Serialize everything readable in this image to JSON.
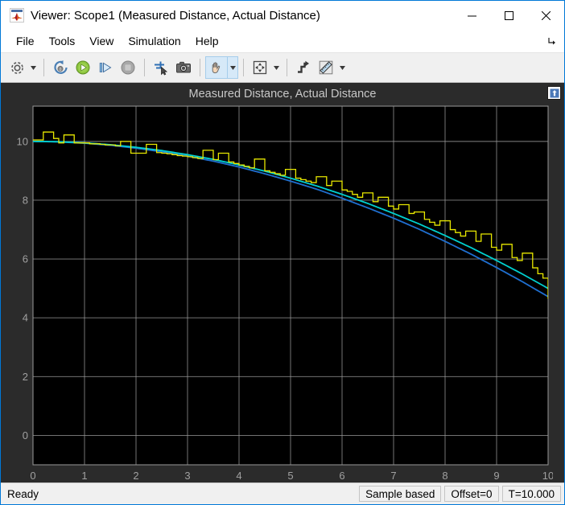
{
  "window": {
    "title": "Viewer: Scope1 (Measured Distance, Actual Distance)",
    "icon": "matlab-logo-icon",
    "minimize_label": "—",
    "maximize_label": "☐",
    "close_label": "✕"
  },
  "menubar": {
    "items": [
      {
        "label": "File"
      },
      {
        "label": "Tools"
      },
      {
        "label": "View"
      },
      {
        "label": "Simulation"
      },
      {
        "label": "Help"
      }
    ],
    "expand_icon": "expand-arrow-icon"
  },
  "toolbar": {
    "buttons": [
      {
        "name": "configuration-properties-button",
        "icon": "gear-icon",
        "tooltip": "Configuration Properties",
        "caret": true,
        "active": false
      },
      {
        "name": "run-back-to-start-button",
        "icon": "rewind-icon",
        "tooltip": "Run back to start",
        "caret": false,
        "active": false
      },
      {
        "name": "run-button",
        "icon": "play-icon",
        "tooltip": "Run",
        "caret": false,
        "active": false
      },
      {
        "name": "step-forward-button",
        "icon": "step-forward-icon",
        "tooltip": "Step Forward",
        "caret": false,
        "active": false
      },
      {
        "name": "stop-button",
        "icon": "stop-icon",
        "tooltip": "Stop",
        "caret": false,
        "active": false
      },
      {
        "name": "simulink-highlight-button",
        "icon": "highlight-signal-icon",
        "tooltip": "Highlight Simulink Block",
        "caret": false,
        "active": false
      },
      {
        "name": "snapshot-button",
        "icon": "camera-icon",
        "tooltip": "Snapshot",
        "caret": false,
        "active": false
      },
      {
        "name": "pan-button",
        "icon": "hand-pan-icon",
        "tooltip": "Pan",
        "caret": true,
        "active": true
      },
      {
        "name": "zoom-fit-button",
        "icon": "scale-axes-icon",
        "tooltip": "Scale Axes Limits",
        "caret": true,
        "active": false
      },
      {
        "name": "style-button",
        "icon": "style-icon",
        "tooltip": "Style",
        "caret": false,
        "active": false
      },
      {
        "name": "measurements-button",
        "icon": "ruler-icon",
        "tooltip": "Measurements",
        "caret": true,
        "active": false
      }
    ]
  },
  "scope": {
    "float_button_icon": "float-panel-icon",
    "colors": {
      "panel_bg": "#2b2b2b",
      "plot_bg": "#000000",
      "grid": "#9a9a9a",
      "axis_text": "#a0a0a0",
      "series_measured": "#e8e800",
      "series_actual_cyan": "#00d0d0",
      "series_actual_blue": "#1f6fd0"
    }
  },
  "statusbar": {
    "ready": "Ready",
    "cells": [
      {
        "name": "status-sample-mode",
        "label": "Sample based"
      },
      {
        "name": "status-offset",
        "label": "Offset=0"
      },
      {
        "name": "status-time",
        "label": "T=10.000"
      }
    ]
  },
  "chart_data": {
    "type": "line",
    "title": "Measured Distance, Actual Distance",
    "xlabel": "",
    "ylabel": "",
    "xlim": [
      0,
      10
    ],
    "ylim": [
      -1.0,
      11.2
    ],
    "xticks": [
      0,
      1,
      2,
      3,
      4,
      5,
      6,
      7,
      8,
      9,
      10
    ],
    "yticks": [
      0,
      2,
      4,
      6,
      8,
      10
    ],
    "grid": true,
    "legend": false,
    "series": [
      {
        "name": "Measured Distance",
        "color": "#e8e800",
        "style": "stairs",
        "x": [
          0.0,
          0.1,
          0.2,
          0.3,
          0.4,
          0.5,
          0.6,
          0.7,
          0.8,
          0.9,
          1.0,
          1.1,
          1.2,
          1.3,
          1.4,
          1.5,
          1.6,
          1.7,
          1.8,
          1.9,
          2.0,
          2.1,
          2.2,
          2.3,
          2.4,
          2.5,
          2.6,
          2.7,
          2.8,
          2.9,
          3.0,
          3.1,
          3.2,
          3.3,
          3.4,
          3.5,
          3.6,
          3.7,
          3.8,
          3.9,
          4.0,
          4.1,
          4.2,
          4.3,
          4.4,
          4.5,
          4.6,
          4.7,
          4.8,
          4.9,
          5.0,
          5.1,
          5.2,
          5.3,
          5.4,
          5.5,
          5.6,
          5.7,
          5.8,
          5.9,
          6.0,
          6.1,
          6.2,
          6.3,
          6.4,
          6.5,
          6.6,
          6.7,
          6.8,
          6.9,
          7.0,
          7.1,
          7.2,
          7.3,
          7.4,
          7.5,
          7.6,
          7.7,
          7.8,
          7.9,
          8.0,
          8.1,
          8.2,
          8.3,
          8.4,
          8.5,
          8.6,
          8.7,
          8.8,
          8.9,
          9.0,
          9.1,
          9.2,
          9.3,
          9.4,
          9.5,
          9.6,
          9.7,
          9.8,
          9.9,
          10.0
        ],
        "y": [
          10.05,
          10.05,
          10.32,
          10.32,
          10.1,
          9.95,
          10.22,
          10.22,
          9.95,
          9.95,
          9.95,
          9.92,
          9.92,
          9.9,
          9.88,
          9.88,
          9.85,
          10.0,
          10.0,
          9.6,
          9.6,
          9.6,
          9.9,
          9.9,
          9.62,
          9.6,
          9.58,
          9.55,
          9.52,
          9.5,
          9.48,
          9.45,
          9.42,
          9.7,
          9.7,
          9.38,
          9.6,
          9.6,
          9.3,
          9.25,
          9.2,
          9.15,
          9.1,
          9.4,
          9.4,
          9.0,
          8.95,
          8.9,
          8.85,
          9.05,
          9.05,
          8.75,
          8.7,
          8.65,
          8.6,
          8.8,
          8.8,
          8.5,
          8.65,
          8.65,
          8.35,
          8.3,
          8.2,
          8.1,
          8.25,
          8.25,
          7.95,
          8.1,
          8.1,
          7.8,
          7.7,
          7.85,
          7.85,
          7.55,
          7.6,
          7.6,
          7.35,
          7.25,
          7.15,
          7.3,
          7.3,
          7.0,
          6.9,
          6.78,
          6.95,
          6.95,
          6.6,
          6.85,
          6.85,
          6.4,
          6.3,
          6.5,
          6.5,
          6.05,
          5.95,
          6.2,
          6.2,
          5.7,
          5.5,
          5.35,
          4.65
        ],
        "description": "Quantized staircase of measured distance, noisy around the true curve"
      },
      {
        "name": "Actual Distance",
        "color": "#00d0d0",
        "style": "line",
        "x": [
          0,
          0.5,
          1,
          1.5,
          2,
          2.5,
          3,
          3.5,
          4,
          4.5,
          5,
          5.5,
          6,
          6.5,
          7,
          7.5,
          8,
          8.5,
          9,
          9.5,
          10
        ],
        "y": [
          10.0,
          9.99,
          9.95,
          9.89,
          9.8,
          9.69,
          9.55,
          9.39,
          9.2,
          8.99,
          8.75,
          8.49,
          8.2,
          7.89,
          7.55,
          7.19,
          6.8,
          6.39,
          5.95,
          5.49,
          5.0
        ],
        "description": "Smooth parabolic reference curve, y = 10 - 0.05*x^2"
      },
      {
        "name": "Actual Distance (overlay)",
        "color": "#1f6fd0",
        "style": "line",
        "x": [
          0,
          0.5,
          1,
          1.5,
          2,
          2.5,
          3,
          3.5,
          4,
          4.5,
          5,
          5.5,
          6,
          6.5,
          7,
          7.5,
          8,
          8.5,
          9,
          9.5,
          10
        ],
        "y": [
          10.0,
          9.985,
          9.94,
          9.87,
          9.77,
          9.65,
          9.5,
          9.33,
          9.13,
          8.9,
          8.65,
          8.38,
          8.07,
          7.74,
          7.39,
          7.01,
          6.6,
          6.17,
          5.71,
          5.23,
          4.72
        ],
        "description": "Second actual-distance trace drawn in dark blue, slightly below the cyan trace"
      }
    ]
  }
}
